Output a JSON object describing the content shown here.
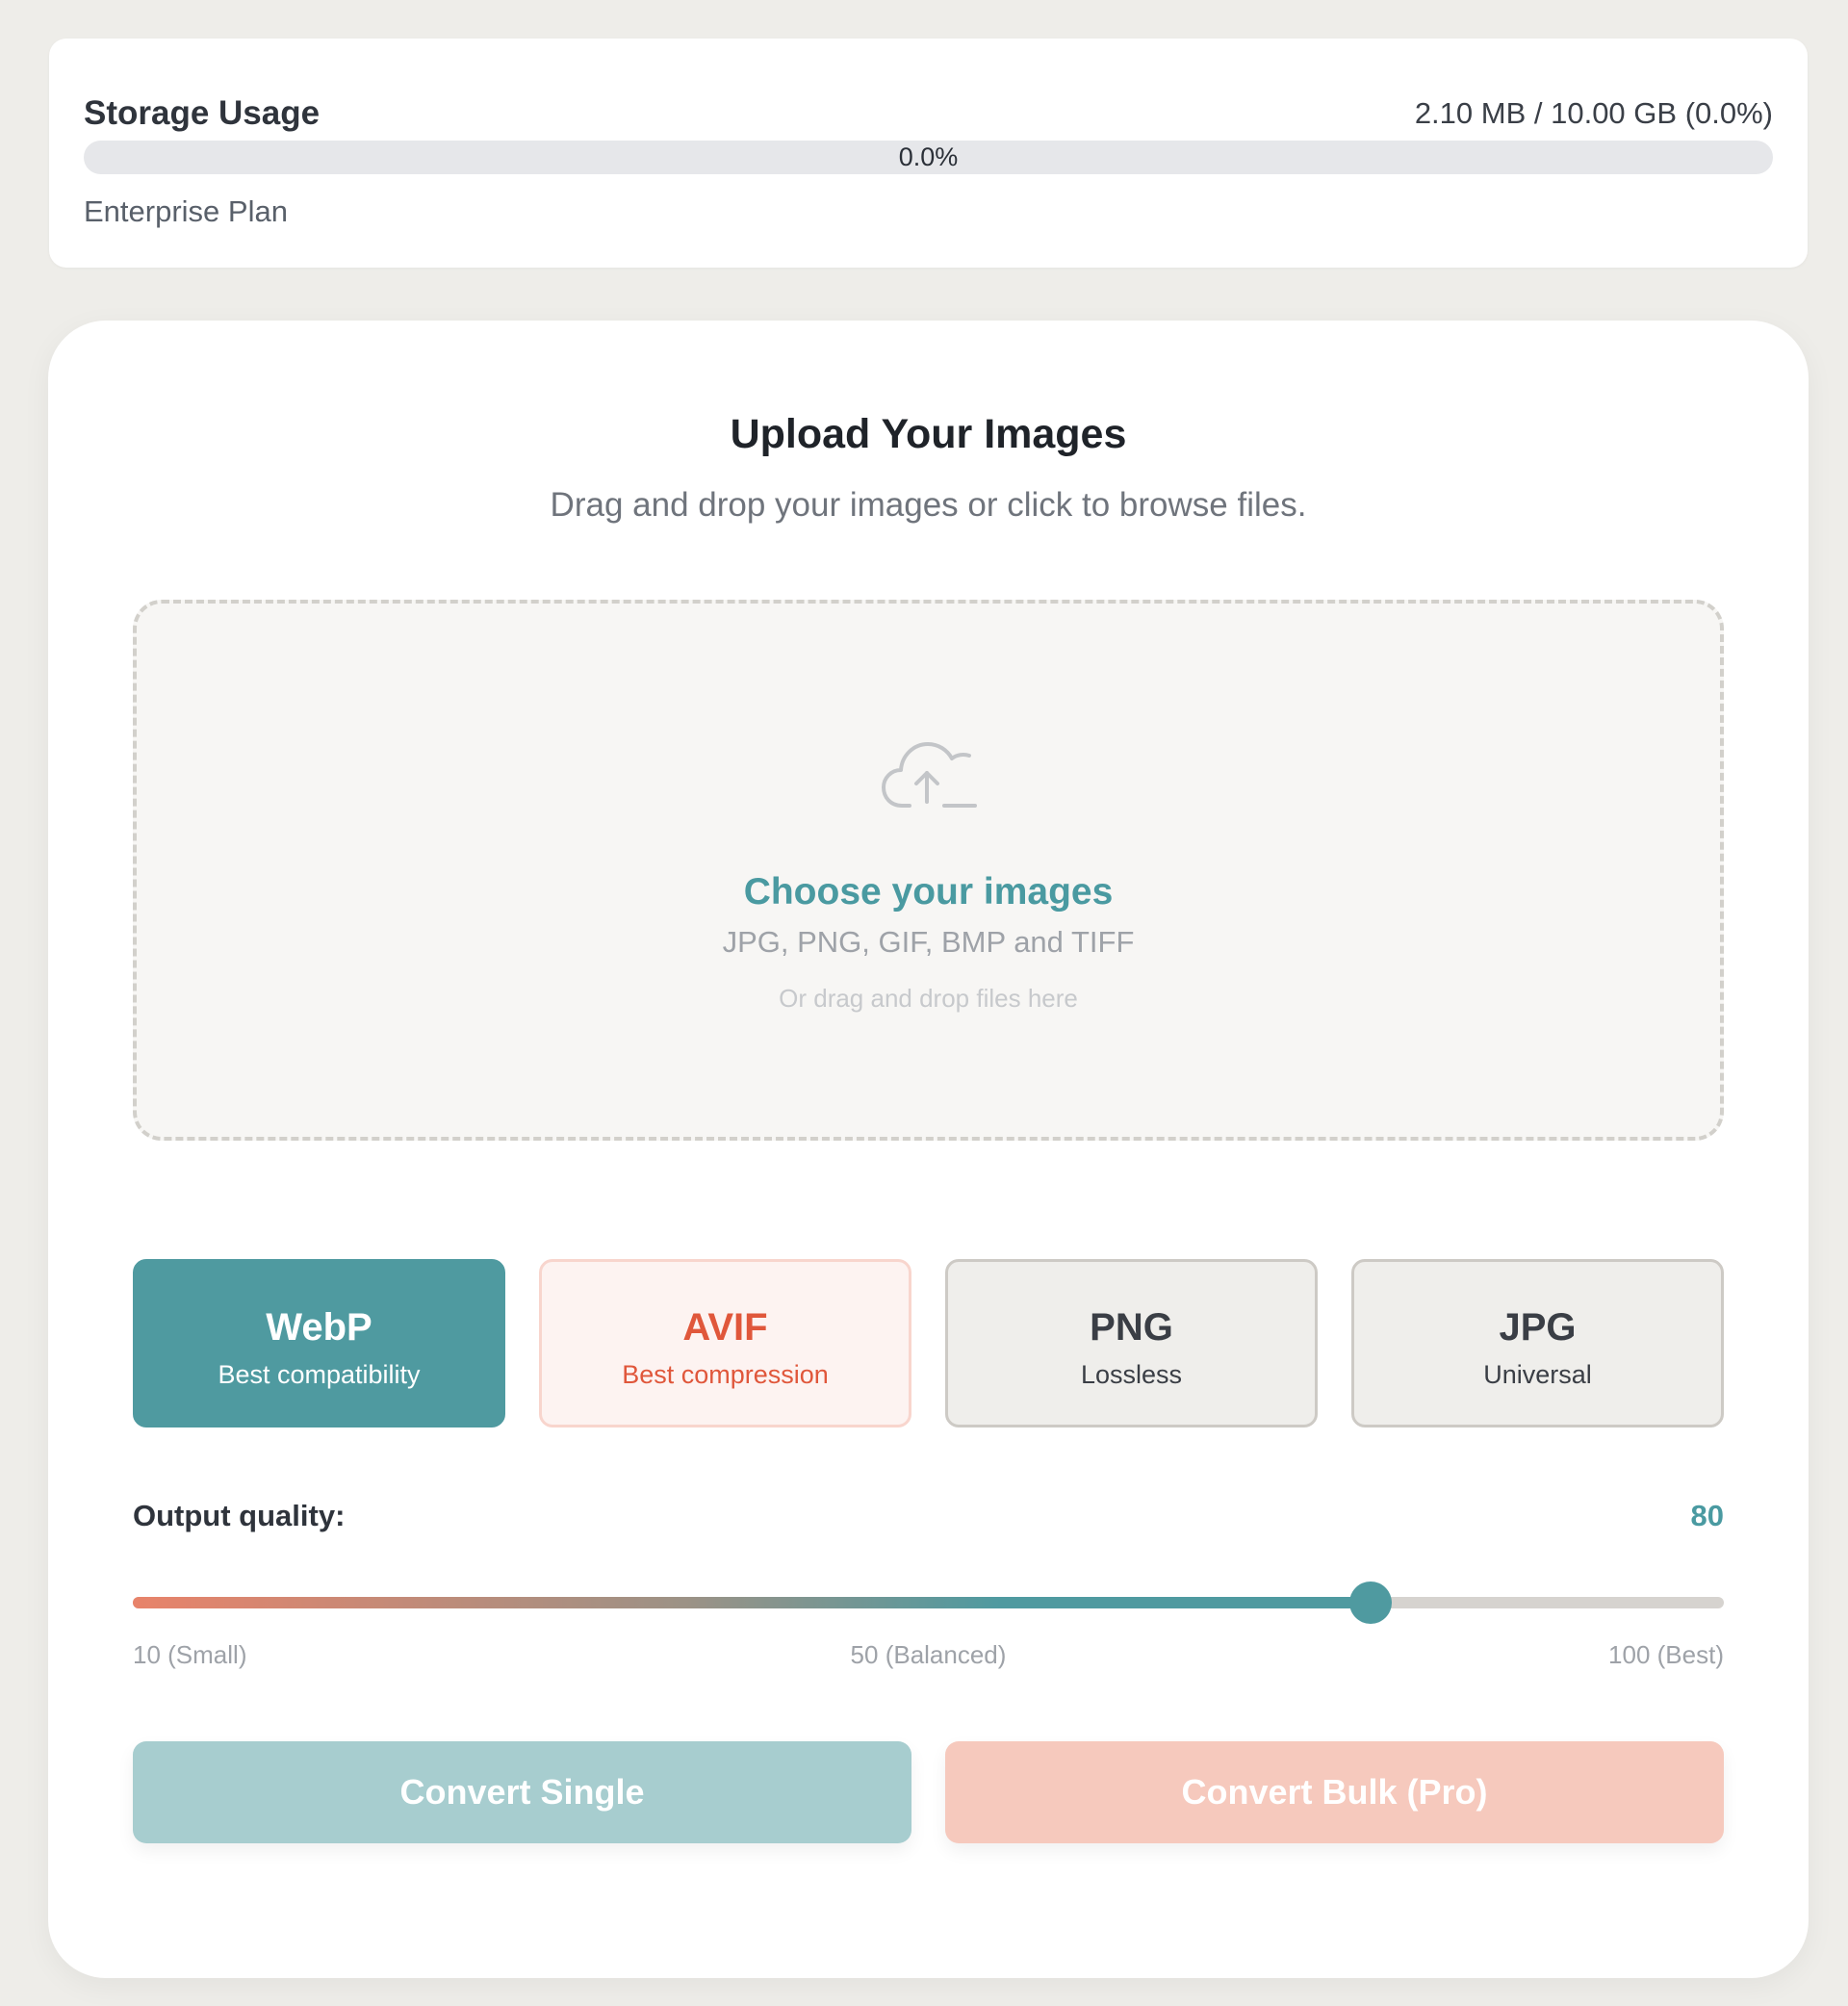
{
  "storage": {
    "title": "Storage Usage",
    "amount": "2.10 MB / 10.00 GB (0.0%)",
    "percent_label": "0.0%",
    "percent_value": 0.0,
    "plan": "Enterprise Plan",
    "bar_fill_color": "#4f9aa0"
  },
  "upload": {
    "title": "Upload Your Images",
    "subtitle": "Drag and drop your images or click to browse files.",
    "dropzone": {
      "icon": "cloud-upload-icon",
      "title": "Choose your images",
      "formats": "JPG, PNG, GIF, BMP and TIFF",
      "hint": "Or drag and drop files here"
    }
  },
  "formats": [
    {
      "name": "WebP",
      "desc": "Best compatibility",
      "selected": true
    },
    {
      "name": "AVIF",
      "desc": "Best compression",
      "selected": false
    },
    {
      "name": "PNG",
      "desc": "Lossless",
      "selected": false
    },
    {
      "name": "JPG",
      "desc": "Universal",
      "selected": false
    }
  ],
  "quality": {
    "label": "Output quality:",
    "value": "80",
    "value_number": 80,
    "min": 10,
    "max": 100,
    "tick_min": "10 (Small)",
    "tick_mid": "50 (Balanced)",
    "tick_max": "100 (Best)"
  },
  "actions": {
    "convert_single": "Convert Single",
    "convert_bulk": "Convert Bulk (Pro)"
  },
  "colors": {
    "accent_teal": "#4f9aa0",
    "accent_coral": "#e0573b",
    "page_background": "#eeede9"
  }
}
